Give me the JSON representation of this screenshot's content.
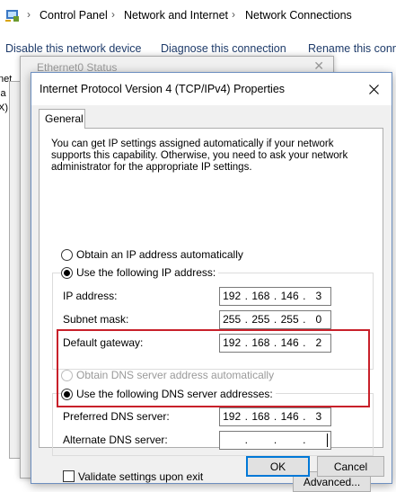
{
  "explorer": {
    "breadcrumb": [
      "Control Panel",
      "Network and Internet",
      "Network Connections"
    ],
    "commands": [
      "Disable this network device",
      "Diagnose this connection",
      "Rename this conne"
    ],
    "left_fragments": [
      "net",
      "ia",
      "X)"
    ]
  },
  "status_window": {
    "title": "Ethernet0 Status"
  },
  "dialog": {
    "title": "Internet Protocol Version 4 (TCP/IPv4) Properties",
    "tab_label": "General",
    "intro_text": "You can get IP settings assigned automatically if your network supports this capability. Otherwise, you need to ask your network administrator for the appropriate IP settings.",
    "ip_auto_label": "Obtain an IP address automatically",
    "ip_manual_label": "Use the following IP address:",
    "ip_address_label": "IP address:",
    "ip_address": [
      "192",
      "168",
      "146",
      "3"
    ],
    "subnet_label": "Subnet mask:",
    "subnet": [
      "255",
      "255",
      "255",
      "0"
    ],
    "gateway_label": "Default gateway:",
    "gateway": [
      "192",
      "168",
      "146",
      "2"
    ],
    "dns_auto_label": "Obtain DNS server address automatically",
    "dns_manual_label": "Use the following DNS server addresses:",
    "preferred_dns_label": "Preferred DNS server:",
    "preferred_dns": [
      "192",
      "168",
      "146",
      "3"
    ],
    "alternate_dns_label": "Alternate DNS server:",
    "alternate_dns": [
      "",
      "",
      "",
      ""
    ],
    "validate_label": "Validate settings upon exit",
    "advanced_label": "Advanced...",
    "ok_label": "OK",
    "cancel_label": "Cancel"
  },
  "colors": {
    "highlight": "#c8202a",
    "accent": "#0078d7"
  }
}
